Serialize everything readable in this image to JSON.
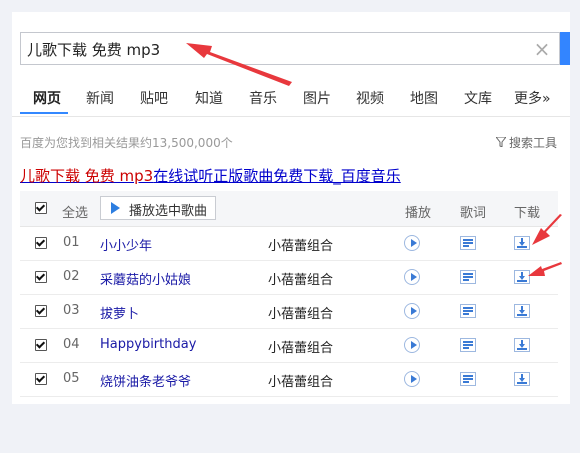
{
  "search": {
    "query": "儿歌下载 免费 mp3"
  },
  "tabs": [
    {
      "label": "网页",
      "active": true
    },
    {
      "label": "新闻"
    },
    {
      "label": "贴吧"
    },
    {
      "label": "知道"
    },
    {
      "label": "音乐"
    },
    {
      "label": "图片"
    },
    {
      "label": "视频"
    },
    {
      "label": "地图"
    },
    {
      "label": "文库"
    },
    {
      "label": "更多»"
    }
  ],
  "result_count": "百度为您找到相关结果约13,500,000个",
  "search_tools": "搜索工具",
  "result": {
    "title_highlight": "儿歌下载 免费 mp3",
    "title_rest": "在线试听正版歌曲免费下载_百度音乐"
  },
  "table": {
    "select_all": "全选",
    "play_selected": "播放选中歌曲",
    "col_play": "播放",
    "col_lyrics": "歌词",
    "col_download": "下载",
    "rows": [
      {
        "num": "01",
        "title": "小小少年",
        "artist": "小蓓蕾组合"
      },
      {
        "num": "02",
        "title": "采蘑菇的小姑娘",
        "artist": "小蓓蕾组合"
      },
      {
        "num": "03",
        "title": "拔萝卜",
        "artist": "小蓓蕾组合"
      },
      {
        "num": "04",
        "title": "Happybirthday",
        "artist": "小蓓蕾组合"
      },
      {
        "num": "05",
        "title": "烧饼油条老爷爷",
        "artist": "小蓓蕾组合"
      }
    ]
  },
  "colors": {
    "accent": "#3385ff",
    "arrow": "#e8383d",
    "link": "#0000cc",
    "highlight": "#cc0000"
  }
}
